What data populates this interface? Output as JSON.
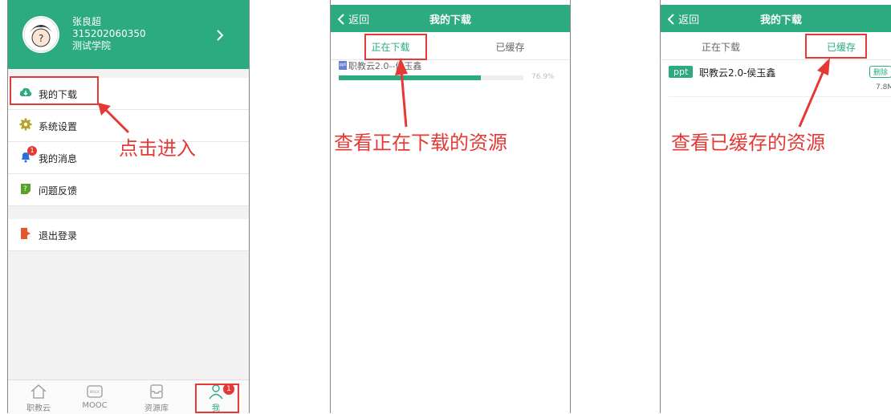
{
  "profile": {
    "name": "张良超",
    "id": "315202060350",
    "school": "测试学院"
  },
  "menu": {
    "downloads": "我的下载",
    "settings": "系统设置",
    "messages": "我的消息",
    "messages_badge": "1",
    "feedback": "问题反馈",
    "logout": "退出登录"
  },
  "tabbar": {
    "items": [
      "职教云",
      "MOOC",
      "资源库",
      "我"
    ],
    "me_badge": "1",
    "mooc_icon_text": "MOOC"
  },
  "annotations": {
    "click_enter": "点击进入",
    "view_downloading": "查看正在下载的资源",
    "view_cached": "查看已缓存的资源"
  },
  "download_page": {
    "back": "返回",
    "title": "我的下载",
    "tab_downloading": "正在下载",
    "tab_cached": "已缓存",
    "item_icon_text": "ppt",
    "item_name": "职教云2.0--侯玉鑫",
    "progress_percent": 76.9,
    "progress_label": "76.9%"
  },
  "cached_page": {
    "back": "返回",
    "title": "我的下载",
    "tab_downloading": "正在下载",
    "tab_cached": "已缓存",
    "item_tag": "ppt",
    "item_name": "职教云2.0-侯玉鑫",
    "delete_label": "删除",
    "size": "7.8M"
  },
  "colors": {
    "brand": "#2bab7f",
    "annotation": "#e53935"
  }
}
